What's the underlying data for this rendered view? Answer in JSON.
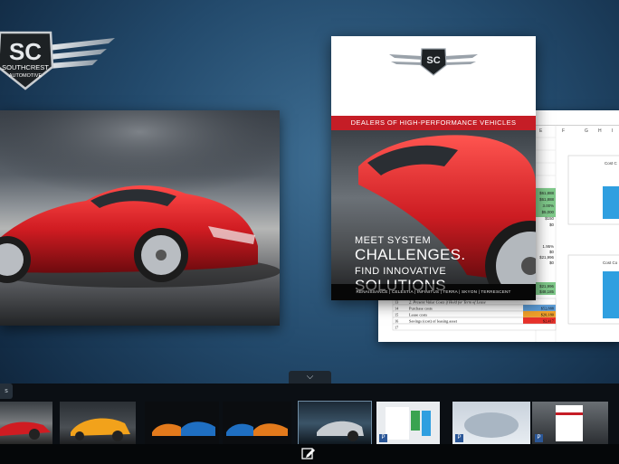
{
  "logo": {
    "initials": "SC",
    "name_line1": "SOUTHCREST",
    "name_line2": "AUTOMOTIVE"
  },
  "brochure": {
    "tagline": "DEALERS OF HIGH-PERFORMANCE VEHICLES",
    "headline_1": "MEET SYSTEM",
    "headline_2": "CHALLENGES.",
    "headline_3": "FIND INNOVATIVE",
    "headline_4": "SOLUTIONS",
    "models": "RENAISSANCE | CELESTIA | INFINITUS | TERRA | SKYON | TERRESCENT",
    "logo_initials": "SC"
  },
  "spreadsheet": {
    "columns": [
      "E",
      "F",
      "G",
      "H",
      "I"
    ],
    "values": [
      "$61,888",
      "$61,888",
      "3.00%",
      "$5,000",
      "$150",
      "$0",
      "1.95%",
      "$0",
      "$21,996",
      "$0",
      "$21,996",
      "$48,185"
    ],
    "rows": [
      {
        "num": "13",
        "label": "2. Present Value Costs if Hold for Term of Lease",
        "value": ""
      },
      {
        "num": "14",
        "label": "Purchase costs",
        "value": "$52,888"
      },
      {
        "num": "15",
        "label": "Lease costs",
        "value": "$20,180"
      },
      {
        "num": "16",
        "label": "Savings (cost) of leasing asset",
        "value": "$2,417"
      },
      {
        "num": "17",
        "label": "",
        "value": ""
      }
    ],
    "chart_title_1": "Cost C",
    "chart_title_2": "Cost Co"
  },
  "thumb_badges": [
    "P",
    "P",
    "P"
  ],
  "strip_toggle_glyph": "⌵",
  "strip_left_glyph": "s",
  "colors": {
    "brand_red": "#c51d26",
    "car_red": "#d01c22",
    "accent_green": "#2e8b3d",
    "excel_blue": "#2b5797"
  }
}
